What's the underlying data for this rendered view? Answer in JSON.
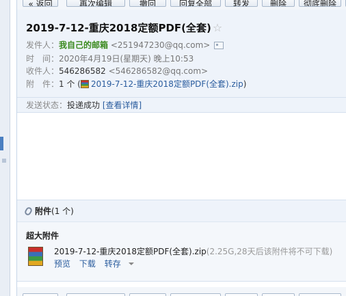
{
  "toolbar": {
    "buttons": [
      "« 返回",
      "再次编辑",
      "撤回",
      "回复全部",
      "转发",
      "删除",
      "彻底删除",
      "彻"
    ]
  },
  "email": {
    "subject": "2019-7-12-重庆2018定额PDF(全套)",
    "star_icon": "☆",
    "from_label": "发件人：",
    "from_name": "我自己的邮箱",
    "from_address": "<251947230@qq.com>",
    "time_label": "时　间：",
    "time_value": "2020年4月19日(星期天) 晚上10:53",
    "to_label": "收件人：",
    "to_name": "546286582",
    "to_address": "<546286582@qq.com>",
    "attach_label": "附　件：",
    "attach_count": "1 个 (",
    "attach_name": "2019-7-12-重庆2018定额PDF(全套).zip",
    "attach_close": ")",
    "status_label": "发送状态：",
    "status_value": "投递成功",
    "status_link": "[查看详情]"
  },
  "attachments": {
    "title": "附件",
    "count_text": "(1 个)",
    "section_label": "超大附件",
    "file_name": "2019-7-12-重庆2018定额PDF(全套).zip",
    "file_meta": "(2.25G,28天后该附件将不可下载)",
    "actions": {
      "preview": "预览",
      "download": "下载",
      "save": "转存"
    }
  },
  "colors": {
    "header_bg": "#eef3fa",
    "link": "#2a5c9e",
    "sender_green": "#3b8a1e"
  },
  "icons": [
    "star-icon",
    "vcard-icon",
    "zip-file-icon",
    "paperclip-icon",
    "dropdown-caret-icon"
  ]
}
